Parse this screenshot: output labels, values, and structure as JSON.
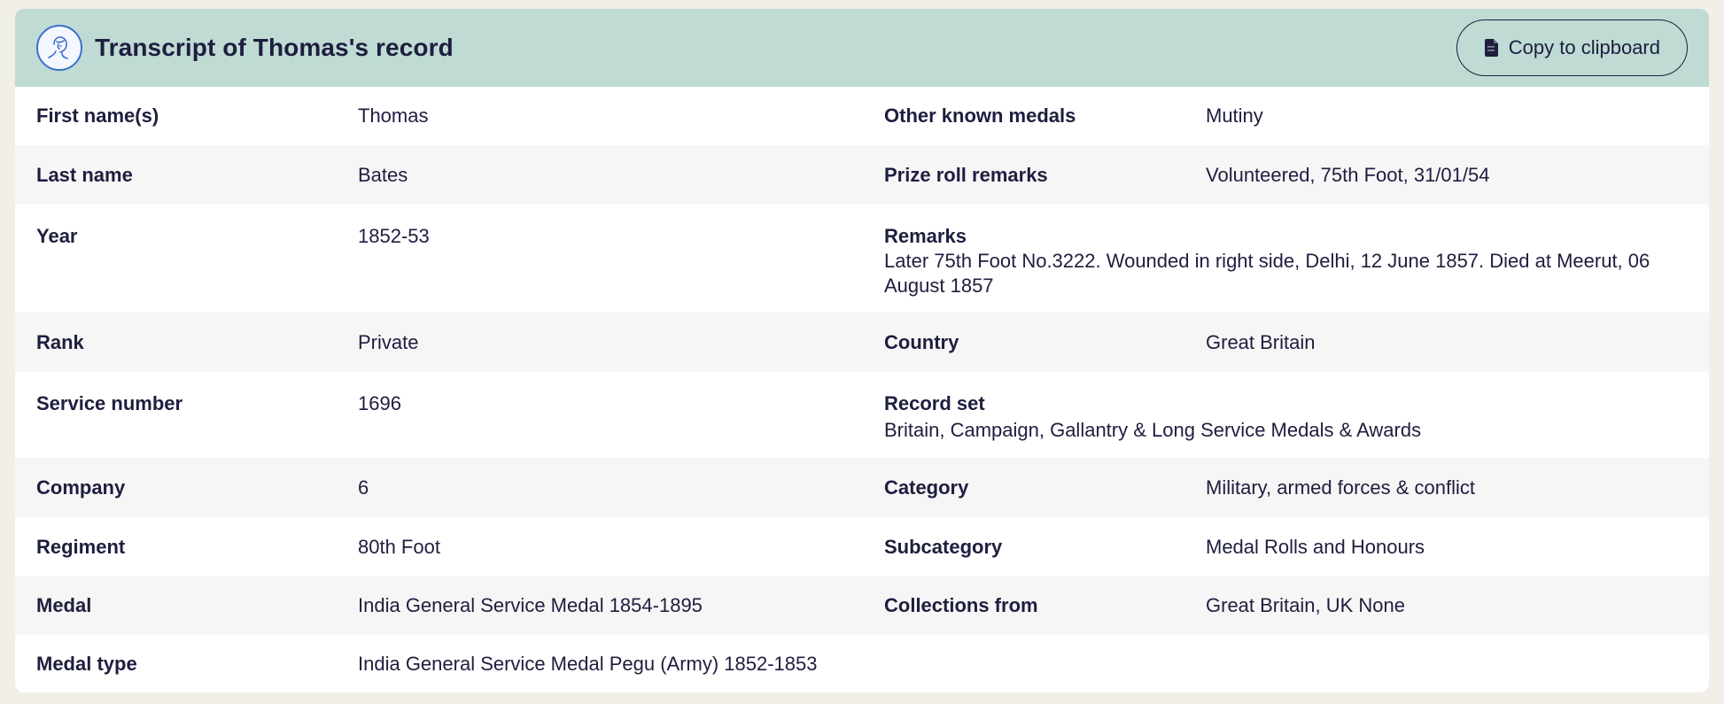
{
  "header": {
    "title": "Transcript of Thomas's record",
    "avatar_icon": "person-portrait-icon",
    "copy_icon": "clipboard-icon",
    "copy_label": "Copy to clipboard",
    "background": "#bfdbd4"
  },
  "rows": [
    {
      "left_label": "First name(s)",
      "left_value": "Thomas",
      "right_label": "Other known medals",
      "right_value": "Mutiny"
    },
    {
      "left_label": "Last name",
      "left_value": "Bates",
      "right_label": "Prize roll remarks",
      "right_value": "Volunteered, 75th Foot, 31/01/54"
    },
    {
      "left_label": "Year",
      "left_value": "1852-53",
      "right_label": "Remarks",
      "right_value": "Later 75th Foot No.3222. Wounded in right side, Delhi, 12 June 1857. Died at Meerut, 06 August 1857"
    },
    {
      "left_label": "Rank",
      "left_value": "Private",
      "right_label": "Country",
      "right_value": "Great Britain"
    },
    {
      "left_label": "Service number",
      "left_value": "1696",
      "right_label": "Record set",
      "right_value": "Britain, Campaign, Gallantry & Long Service Medals & Awards"
    },
    {
      "left_label": "Company",
      "left_value": "6",
      "right_label": "Category",
      "right_value": "Military, armed forces & conflict"
    },
    {
      "left_label": "Regiment",
      "left_value": "80th Foot",
      "right_label": "Subcategory",
      "right_value": "Medal Rolls and Honours"
    },
    {
      "left_label": "Medal",
      "left_value": "India General Service Medal 1854-1895",
      "right_label": "Collections from",
      "right_value": "Great Britain, UK None"
    },
    {
      "left_label": "Medal type",
      "left_value": "India General Service Medal Pegu (Army) 1852-1853"
    }
  ]
}
